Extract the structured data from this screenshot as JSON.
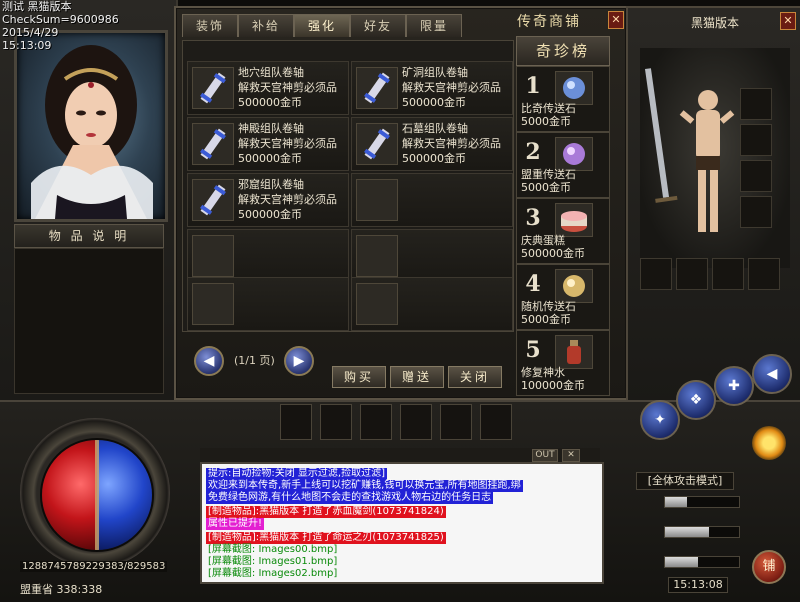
{
  "hud_info": {
    "line1": "测试 黑猫版本",
    "line2": "CheckSum=9600986",
    "line3": "2015/4/29",
    "line4": "15:13:09"
  },
  "left_panel": {
    "desc_title": "物 品 说 明"
  },
  "shop": {
    "title": "传奇商铺",
    "close": "✕",
    "tabs": [
      {
        "label": "装饰",
        "active": false
      },
      {
        "label": "补给",
        "active": false
      },
      {
        "label": "强化",
        "active": true
      },
      {
        "label": "好友",
        "active": false
      },
      {
        "label": "限量",
        "active": false
      }
    ],
    "items": [
      {
        "name": "地穴组队卷轴",
        "desc": "解救天宫神剪必须品",
        "price": "500000金币"
      },
      {
        "name": "矿洞组队卷轴",
        "desc": "解救天宫神剪必须品",
        "price": "500000金币"
      },
      {
        "name": "神殿组队卷轴",
        "desc": "解救天宫神剪必须品",
        "price": "500000金币"
      },
      {
        "name": "石墓组队卷轴",
        "desc": "解救天宫神剪必须品",
        "price": "500000金币"
      },
      {
        "name": "邪窟组队卷轴",
        "desc": "解救天宫神剪必须品",
        "price": "500000金币"
      }
    ],
    "rare_header": "奇珍榜",
    "rare_items": [
      {
        "rank": "1",
        "name": "比奇传送石",
        "price": "5000金币"
      },
      {
        "rank": "2",
        "name": "盟重传送石",
        "price": "5000金币"
      },
      {
        "rank": "3",
        "name": "庆典蛋糕",
        "price": "500000金币"
      },
      {
        "rank": "4",
        "name": "随机传送石",
        "price": "5000金币"
      },
      {
        "rank": "5",
        "name": "修复神水",
        "price": "100000金币"
      }
    ],
    "page_label": "(1/1 页)",
    "buttons": {
      "buy": "购买",
      "gift": "赠送",
      "close": "关闭"
    }
  },
  "equip": {
    "title": "黑猫版本",
    "close": "✕"
  },
  "chat": {
    "out_label": "OUT",
    "x_label": "✕",
    "lines": [
      {
        "text": "提示:自动捡物:关闭 显示过滤,捡取过滤]",
        "bg": "#2222d6",
        "fg": "#ffffff"
      },
      {
        "text": "欢迎来到本传奇,新手上线可以挖矿赚钱,钱可以换元宝,所有地图挂跑,绑",
        "bg": "#2222d6",
        "fg": "#ffffff"
      },
      {
        "text": "免费绿色网游,有什么地图不会走的查找游戏人物右边的任务日志",
        "bg": "#2222d6",
        "fg": "#ffffff"
      },
      {
        "text": "[制造物品]:黑猫版本 打造了赤血魔剑(1073741824)",
        "bg": "#e0121e",
        "fg": "#ffffff"
      },
      {
        "text": "属性已提升!",
        "bg": "#e31fd1",
        "fg": "#ffffff"
      },
      {
        "text": "[制造物品]:黑猫版本 打造了命运之刃(1073741825)",
        "bg": "#e0121e",
        "fg": "#ffffff"
      },
      {
        "text": "[屏幕截图: Images00.bmp]",
        "bg": "#f6f6f6",
        "fg": "#0a8a0a"
      },
      {
        "text": "[屏幕截图: Images01.bmp]",
        "bg": "#f6f6f6",
        "fg": "#0a8a0a"
      },
      {
        "text": "[屏幕截图: Images02.bmp]",
        "bg": "#f6f6f6",
        "fg": "#0a8a0a"
      }
    ]
  },
  "bottom": {
    "hp_mp": "1288745789229383/829583",
    "map": "盟重省  338:338",
    "attack_mode": "[全体攻击模式]",
    "clock": "15:13:08",
    "shop_button": "铺",
    "hp_fraction": 0.5,
    "mp_fraction": 0.5
  },
  "colors": {
    "accent_gold": "#c9a96b",
    "hp_red": "#c3151a",
    "mp_blue": "#2145c9",
    "chat_sys_blue": "#2222d6",
    "chat_make_red": "#e0121e",
    "chat_shot_green": "#0a8a0a"
  },
  "icons": {
    "scroll": "scroll-icon",
    "stone": "teleport-stone-icon",
    "cake": "cake-icon",
    "potion": "potion-icon",
    "sword": "sword-icon"
  }
}
